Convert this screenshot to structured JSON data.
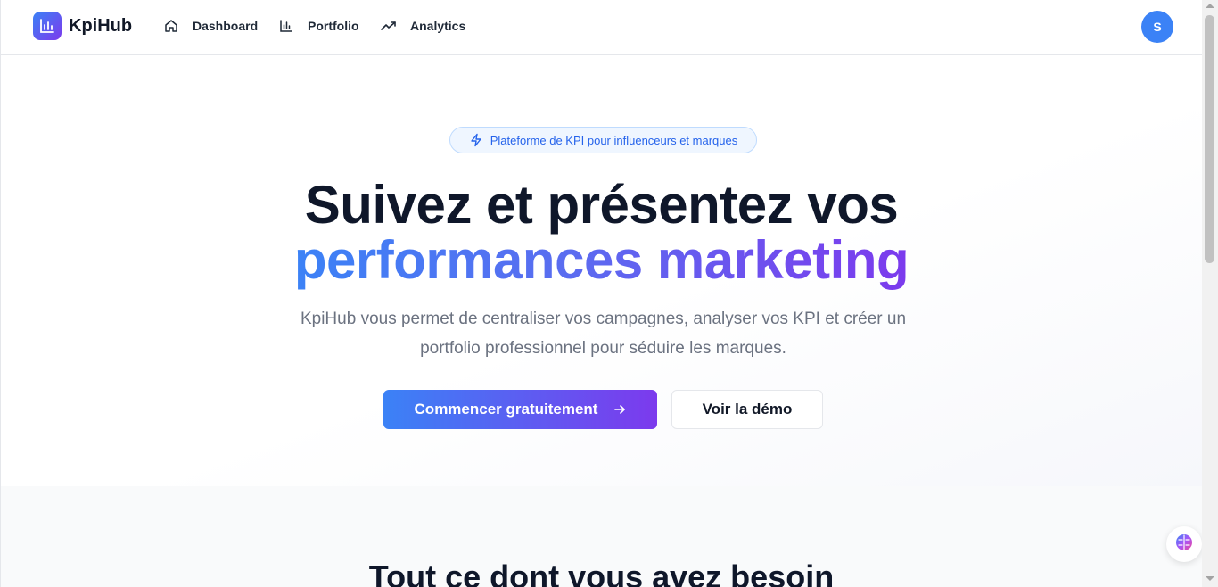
{
  "brand": {
    "name": "KpiHub"
  },
  "nav": {
    "items": [
      {
        "label": "Dashboard",
        "icon": "home-icon"
      },
      {
        "label": "Portfolio",
        "icon": "bar-chart-icon"
      },
      {
        "label": "Analytics",
        "icon": "trending-up-icon"
      }
    ],
    "avatar_initial": "S"
  },
  "hero": {
    "badge": "Plateforme de KPI pour influenceurs et marques",
    "title_line1": "Suivez et présentez vos",
    "title_line2": "performances marketing",
    "subtitle": "KpiHub vous permet de centraliser vos campagnes, analyser vos KPI et créer un portfolio professionnel pour séduire les marques.",
    "cta_primary": "Commencer gratuitement",
    "cta_secondary": "Voir la démo"
  },
  "features": {
    "title": "Tout ce dont vous avez besoin"
  },
  "colors": {
    "primary_start": "#3b82f6",
    "primary_end": "#7c3aed",
    "text_dark": "#0f172a",
    "text_muted": "#6b7280",
    "badge_bg": "#eff6ff",
    "badge_text": "#2563eb",
    "avatar_bg": "#3b82f6"
  }
}
